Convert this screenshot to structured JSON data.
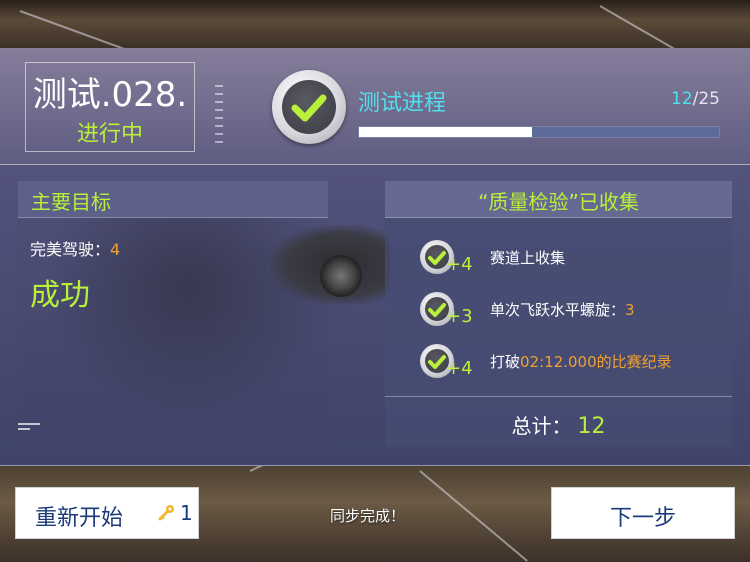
{
  "header": {
    "test_id": "测试.028.",
    "test_state": "进行中",
    "progress_title": "测试进程",
    "progress_current": "12",
    "progress_total": "/25",
    "progress_fraction": 0.48
  },
  "primary": {
    "title": "主要目标",
    "objective_label": "完美驾驶：",
    "objective_value": "4",
    "result": "成功"
  },
  "collected": {
    "title": "“质量检验”已收集",
    "items": [
      {
        "plus": "+4",
        "label": "赛道上收集",
        "highlight": "",
        "suffix": ""
      },
      {
        "plus": "+3",
        "label": "单次飞跃水平螺旋：",
        "highlight": "3",
        "suffix": ""
      },
      {
        "plus": "+4",
        "label": "打破",
        "highlight": "02:12.000的比赛纪录",
        "suffix": ""
      }
    ],
    "total_label": "总计：",
    "total_value": "12"
  },
  "footer": {
    "restart_label": "重新开始",
    "restart_count": "1",
    "sync_text": "同步完成！",
    "next_label": "下一步"
  },
  "colors": {
    "accent_green": "#b8f03a",
    "accent_cyan": "#4fe0ee",
    "accent_orange": "#f0a030",
    "button_text": "#1b3a7a"
  },
  "icons": [
    "checkmark-icon",
    "key-icon"
  ]
}
